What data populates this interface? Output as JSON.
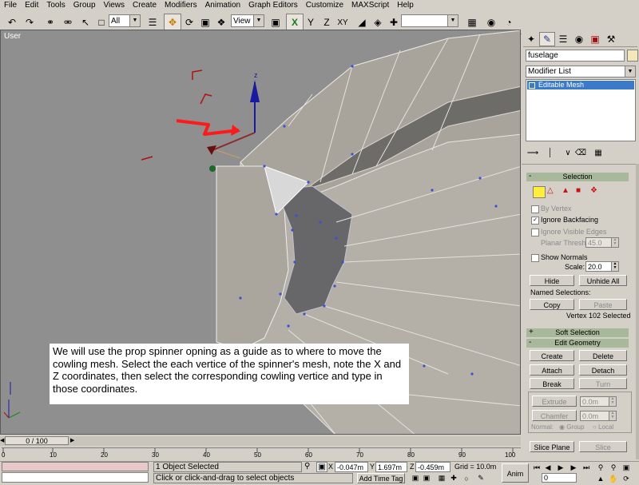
{
  "menu": [
    "File",
    "Edit",
    "Tools",
    "Group",
    "Views",
    "Create",
    "Modifiers",
    "Animation",
    "Graph Editors",
    "Customize",
    "MAXScript",
    "Help"
  ],
  "toolbar": {
    "selection_filter": "All",
    "ref_coord": "View",
    "axis_x": "X",
    "axis_y": "Y",
    "axis_z": "Z",
    "axis_xy": "XY",
    "named_set": ""
  },
  "viewport": {
    "label": "User",
    "axis_z": "z",
    "note": "We will use the prop spinner opning as a guide as to where to move the cowling mesh.  Select the each vertice of the spinner's mesh, note the X and Z coordinates, then select the corresponding cowling vertice and type in those coordinates."
  },
  "command_panel": {
    "object_name": "fuselage",
    "object_color": "#f4e8b8",
    "modifier_list_label": "Modifier List",
    "stack_item": "Editable Mesh",
    "selection": {
      "title": "Selection",
      "by_vertex": "By Vertex",
      "ignore_backfacing": "Ignore Backfacing",
      "ignore_visible_edges": "Ignore Visible Edges",
      "planar_thresh_label": "Planar Thresh:",
      "planar_thresh_value": "45.0",
      "show_normals": "Show Normals",
      "scale_label": "Scale:",
      "scale_value": "20.0",
      "hide": "Hide",
      "unhide_all": "Unhide All",
      "named_selections": "Named Selections:",
      "copy": "Copy",
      "paste": "Paste",
      "status": "Vertex 102 Selected"
    },
    "soft_selection_title": "Soft Selection",
    "edit_geometry": {
      "title": "Edit Geometry",
      "create": "Create",
      "delete": "Delete",
      "attach": "Attach",
      "detach": "Detach",
      "break": "Break",
      "turn": "Turn",
      "extrude": "Extrude",
      "extrude_value": "0.0m",
      "chamfer": "Chamfer",
      "chamfer_value": "0.0m",
      "normal_label": "Normal:",
      "group": "Group",
      "local": "Local",
      "slice_plane": "Slice Plane",
      "slice": "Slice"
    }
  },
  "trackbar": {
    "frame": "0 / 100",
    "ticks": [
      "0",
      "10",
      "20",
      "30",
      "40",
      "50",
      "60",
      "70",
      "80",
      "90",
      "100"
    ]
  },
  "status": {
    "selection": "1 Object Selected",
    "prompt": "Click or click-and-drag to select objects",
    "x_label": "X",
    "x_value": "-0.047m",
    "y_label": "Y",
    "y_value": "1.697m",
    "z_label": "Z",
    "z_value": "-0.459m",
    "grid": "Grid = 10.0m",
    "add_time_tag": "Add Time Tag",
    "anim": "Anim",
    "frame_value": "0"
  }
}
